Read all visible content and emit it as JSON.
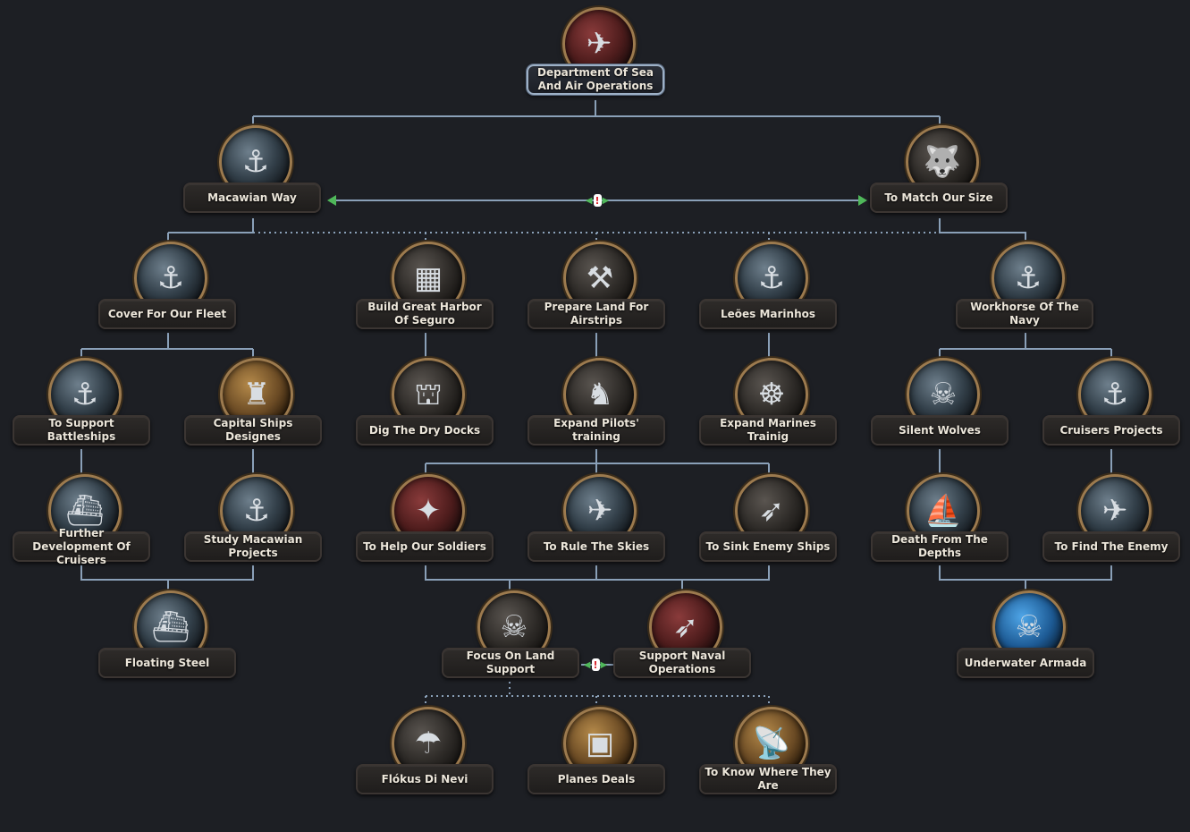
{
  "focus_tree": {
    "root": {
      "label": "Department Of Sea And Air Operations",
      "icon": "carrier-plane-icon"
    },
    "macawian_way": {
      "label": "Macawian Way",
      "icon": "battleship-icon"
    },
    "to_match_our_size": {
      "label": "To Match Our Size",
      "icon": "wolf-icon"
    },
    "cover_for_our_fleet": {
      "label": "Cover For Our Fleet",
      "icon": "anchor-ship-icon"
    },
    "build_great_harbor": {
      "label": "Build Great Harbor Of Seguro",
      "icon": "crane-crate-icon"
    },
    "prepare_land_airstrips": {
      "label": "Prepare Land For Airstrips",
      "icon": "crossed-tools-icon"
    },
    "leoes_marinhos": {
      "label": "Leões Marinhos",
      "icon": "anchor-icon"
    },
    "workhorse_navy": {
      "label": "Workhorse Of The Navy",
      "icon": "anchor-ship-icon"
    },
    "support_battleships": {
      "label": "To Support Battleships",
      "icon": "anchor-ship-icon"
    },
    "capital_ships": {
      "label": "Capital Ships Designes",
      "icon": "warship-laurel-icon"
    },
    "dry_docks": {
      "label": "Dig The Dry Docks",
      "icon": "dock-crane-icon"
    },
    "expand_pilots": {
      "label": "Expand Pilots' training",
      "icon": "chess-knight-wings-icon"
    },
    "expand_marines": {
      "label": "Expand Marines Trainig",
      "icon": "ship-wheel-icon"
    },
    "silent_wolves": {
      "label": "Silent Wolves",
      "icon": "skull-submarine-icon"
    },
    "cruisers_projects": {
      "label": "Cruisers Projects",
      "icon": "anchor-ship-icon"
    },
    "further_cruisers": {
      "label": "Further Development Of Cruisers",
      "icon": "cruiser-icon"
    },
    "study_macawian": {
      "label": "Study Macawian Projects",
      "icon": "anchor-ship-icon"
    },
    "help_soldiers": {
      "label": "To Help Our Soldiers",
      "icon": "bombs-icon"
    },
    "rule_skies": {
      "label": "To Rule The Skies",
      "icon": "fighter-plane-icon"
    },
    "sink_enemy": {
      "label": "To Sink Enemy Ships",
      "icon": "torpedo-icon"
    },
    "death_depths": {
      "label": "Death From The Depths",
      "icon": "submarine-icon"
    },
    "find_enemy": {
      "label": "To Find The Enemy",
      "icon": "scout-plane-icon"
    },
    "floating_steel": {
      "label": "Floating Steel",
      "icon": "fleet-icon"
    },
    "focus_land_support": {
      "label": "Focus On Land Support",
      "icon": "winged-skull-icon"
    },
    "support_naval_ops": {
      "label": "Support Naval Operations",
      "icon": "naval-bomb-icon"
    },
    "underwater_armada": {
      "label": "Underwater Armada",
      "icon": "skull-fleet-icon"
    },
    "flokus_di_nevi": {
      "label": "Flókus Di Nevi",
      "icon": "parachute-icon"
    },
    "planes_deals": {
      "label": "Planes Deals",
      "icon": "treasure-chest-icon"
    },
    "to_know_where": {
      "label": "To Know Where They Are",
      "icon": "radar-tower-icon"
    },
    "exclusive_marker_icon": "mutually-exclusive-icon"
  }
}
